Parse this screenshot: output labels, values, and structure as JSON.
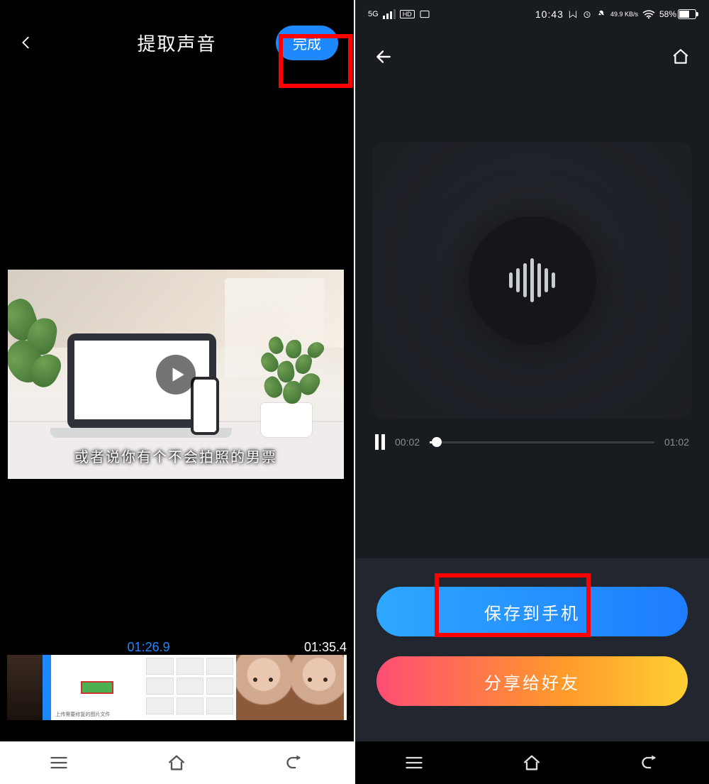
{
  "left": {
    "title": "提取声音",
    "done_label": "完成",
    "video_subtitle": "或者说你有个不会拍照的男票",
    "strip_caption_1": "上传需要修复的图片文件",
    "current_time": "01:26.9",
    "total_time": "01:35.4"
  },
  "right": {
    "status": {
      "network": "5G",
      "hd": "HD",
      "time": "10:43",
      "speed": "49.9 KB/s",
      "battery_pct": "58%"
    },
    "player": {
      "elapsed": "00:02",
      "duration": "01:02"
    },
    "actions": {
      "save": "保存到手机",
      "share": "分享给好友"
    }
  }
}
